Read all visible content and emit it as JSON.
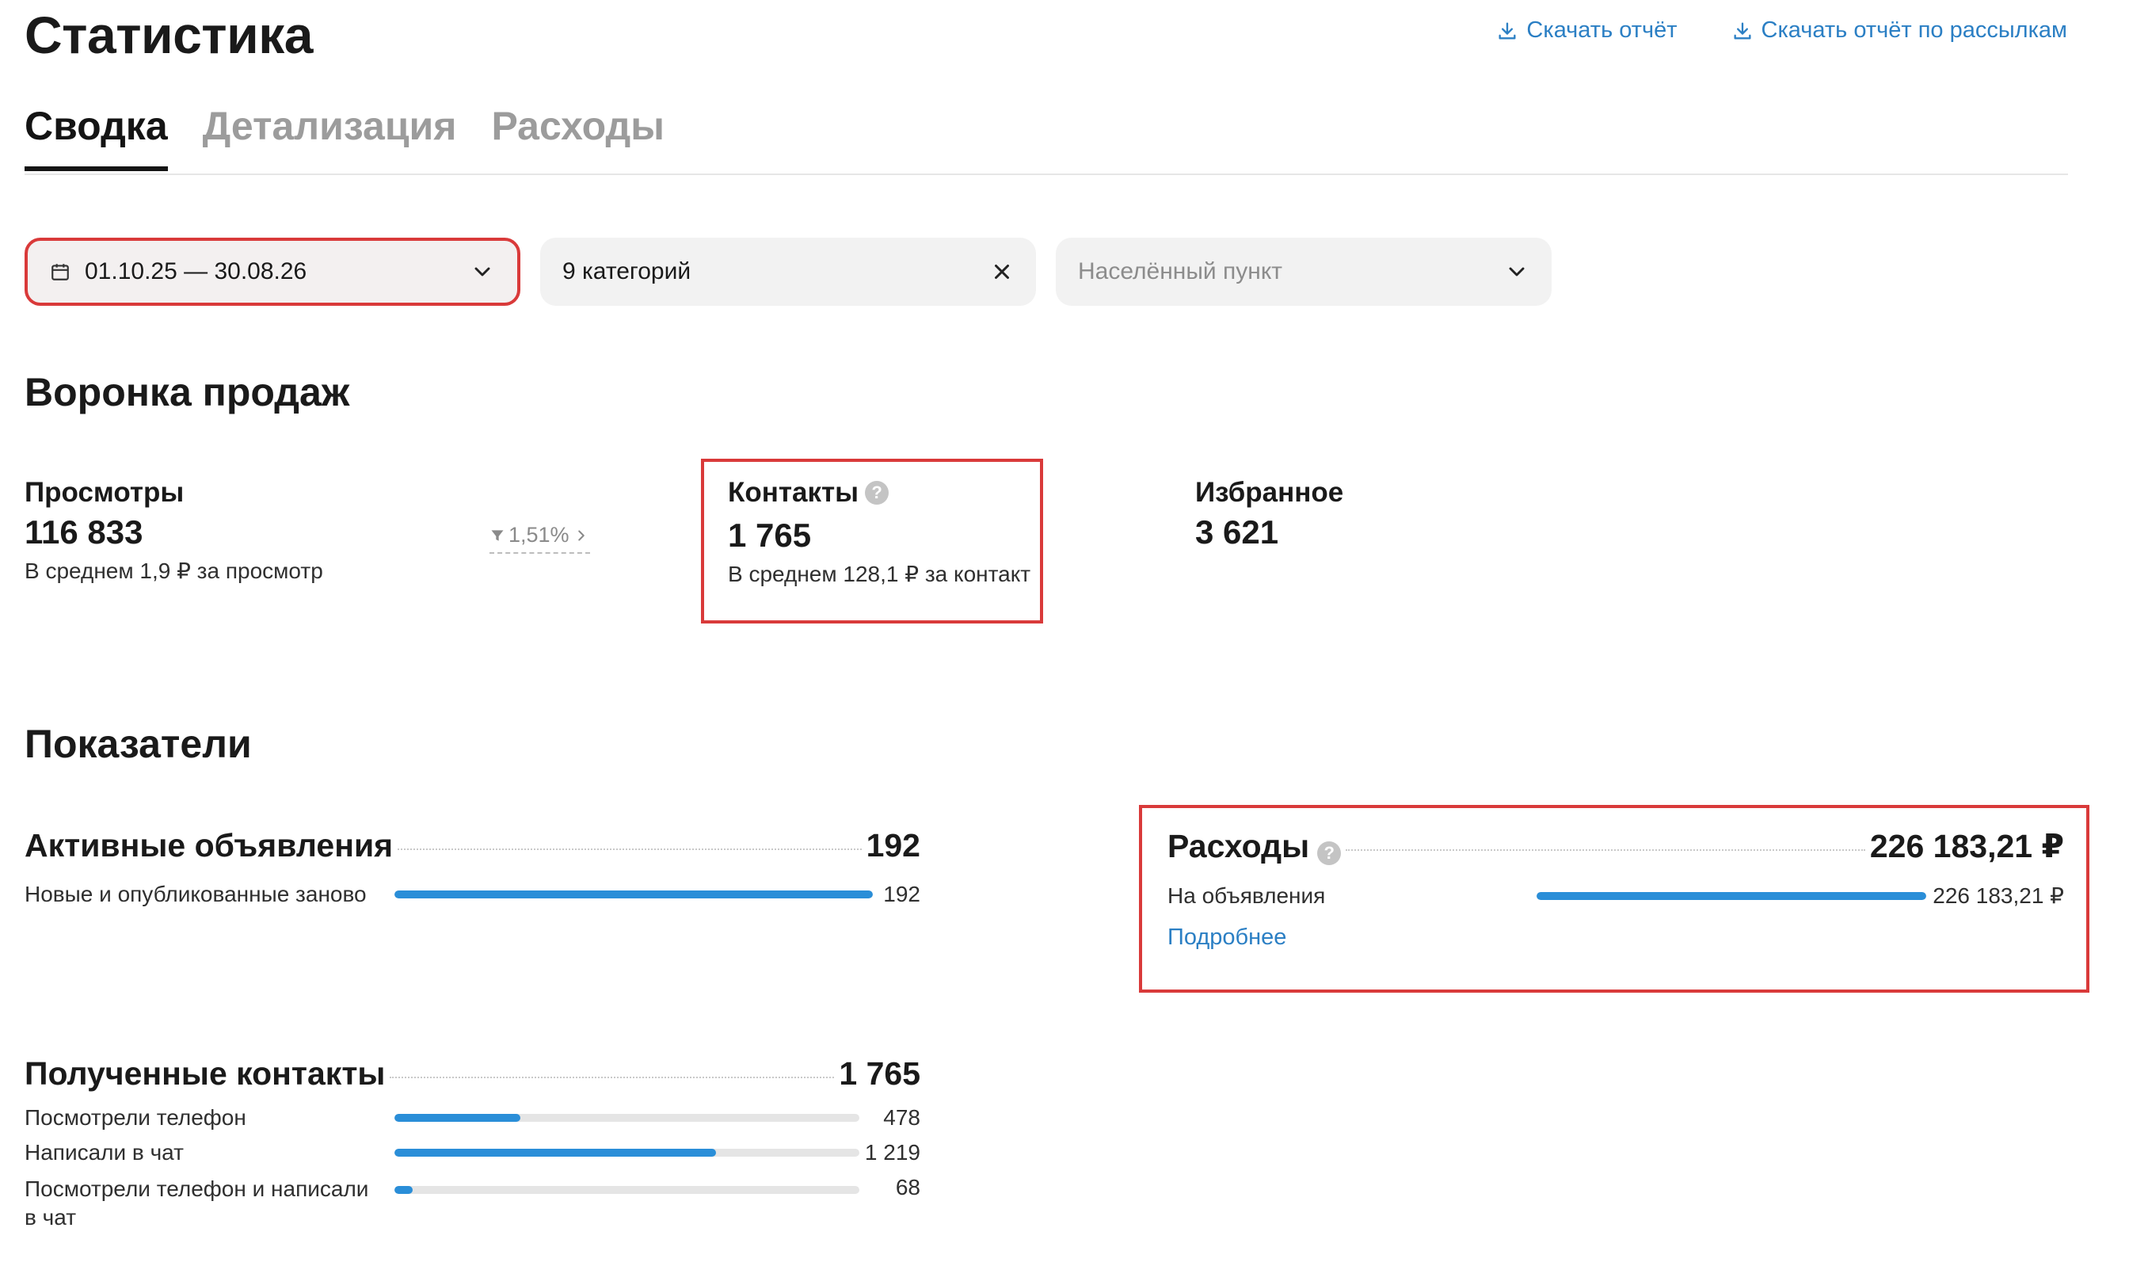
{
  "header": {
    "title": "Статистика",
    "download_report": "Скачать отчёт",
    "download_mailing_report": "Скачать отчёт по рассылкам"
  },
  "tabs": [
    {
      "label": "Сводка",
      "active": true
    },
    {
      "label": "Детализация",
      "active": false
    },
    {
      "label": "Расходы",
      "active": false
    }
  ],
  "filters": {
    "date_range": "01.10.25 — 30.08.26",
    "categories": "9 категорий",
    "city_placeholder": "Населённый пункт"
  },
  "funnel": {
    "title": "Воронка продаж",
    "views": {
      "label": "Просмотры",
      "value": "116 833",
      "sub": "В среднем 1,9 ₽ за просмотр"
    },
    "conversion": "1,51%",
    "contacts": {
      "label": "Контакты",
      "value": "1 765",
      "sub": "В среднем 128,1 ₽ за контакт"
    },
    "favorites": {
      "label": "Избранное",
      "value": "3 621"
    }
  },
  "indicators": {
    "title": "Показатели",
    "active_ads": {
      "title": "Активные объявления",
      "total": "192",
      "rows": [
        {
          "label": "Новые и опубликованные заново",
          "value": "192",
          "fraction": 1.0
        }
      ]
    },
    "expenses": {
      "title": "Расходы",
      "total": "226 183,21 ₽",
      "rows": [
        {
          "label": "На объявления",
          "value": "226 183,21 ₽",
          "fraction": 1.0
        }
      ],
      "more": "Подробнее"
    },
    "contacts_received": {
      "title": "Полученные контакты",
      "total": "1 765",
      "rows": [
        {
          "label": "Посмотрели телефон",
          "value": "478",
          "fraction": 0.271
        },
        {
          "label": "Написали в чат",
          "value": "1 219",
          "fraction": 0.691
        },
        {
          "label": "Посмотрели телефон и написали в чат",
          "value": "68",
          "fraction": 0.039
        }
      ]
    }
  },
  "colors": {
    "accent_blue": "#2a8ed8",
    "link_blue": "#2b7fc4",
    "highlight_red": "#d93a3a"
  }
}
